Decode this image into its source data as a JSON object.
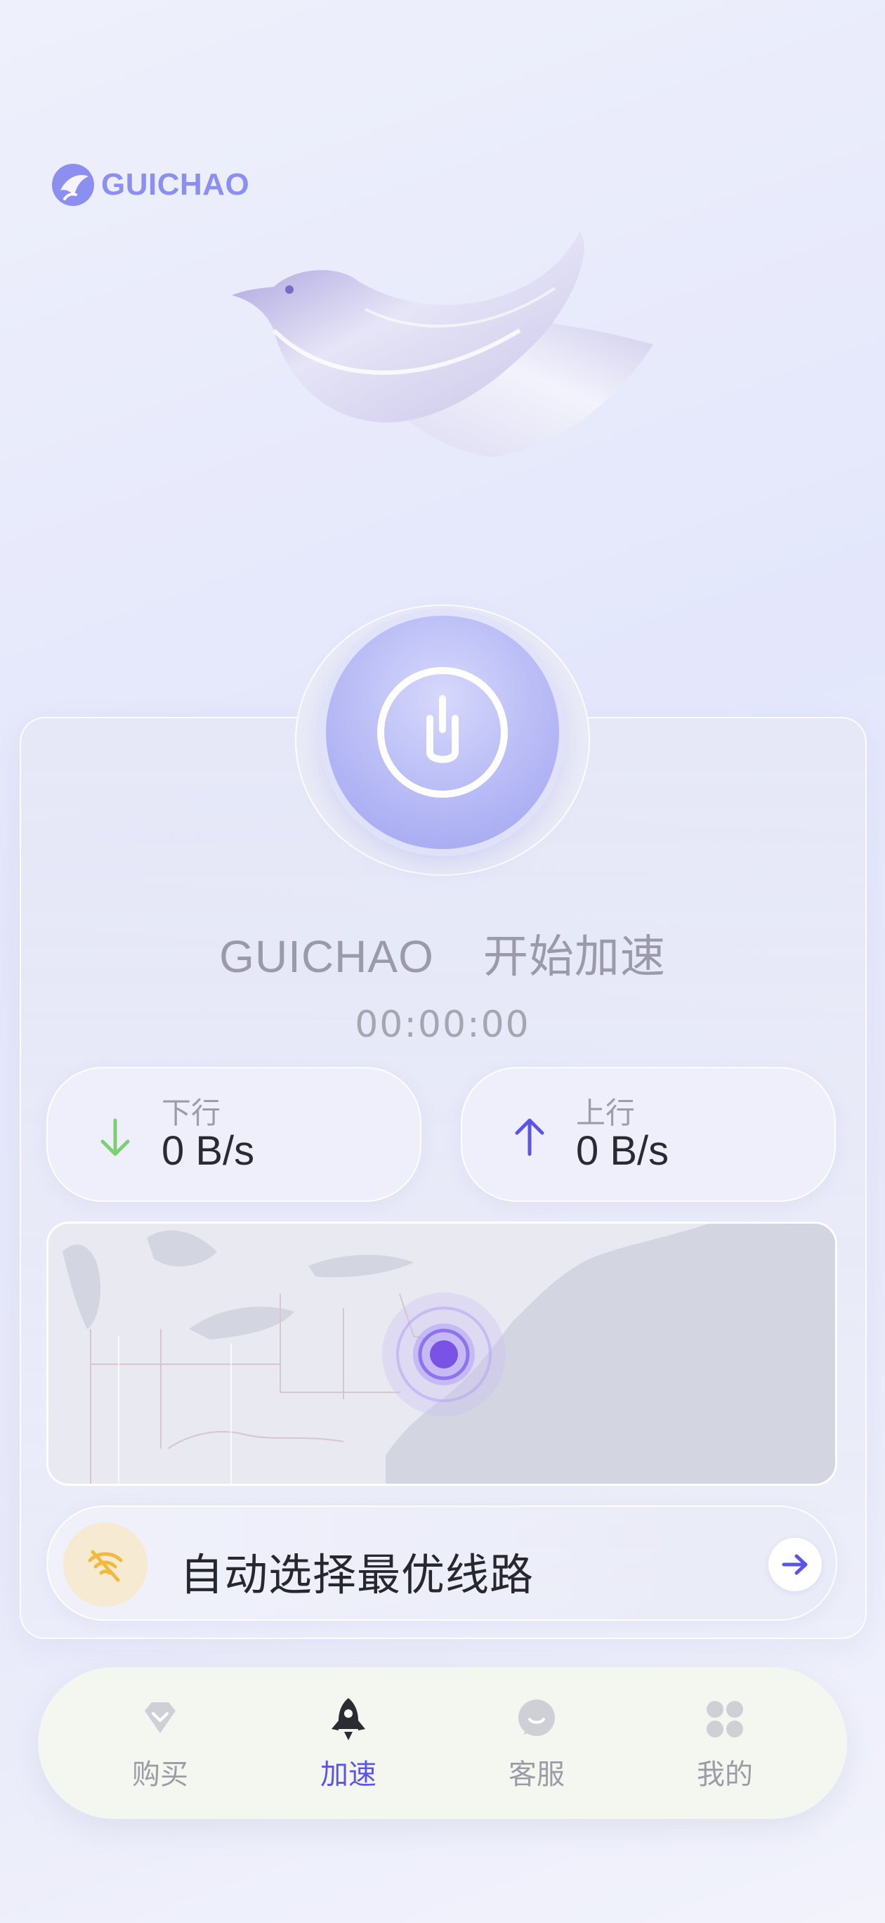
{
  "brand": {
    "name": "GUICHAO",
    "accent": "#6b63e6"
  },
  "main": {
    "title_brand": "GUICHAO",
    "title_action": "开始加速",
    "timer": "00:00:00",
    "download": {
      "label": "下行",
      "value": "0 B/s",
      "icon": "arrow-down-icon",
      "color": "#7ccf72"
    },
    "upload": {
      "label": "上行",
      "value": "0 B/s",
      "icon": "arrow-up-icon",
      "color": "#5b55e6"
    },
    "route": {
      "label": "自动选择最优线路",
      "icon": "wifi-off-icon",
      "action_icon": "arrow-right-icon"
    }
  },
  "tabs": [
    {
      "label": "购买",
      "icon": "diamond-icon",
      "active": false
    },
    {
      "label": "加速",
      "icon": "rocket-icon",
      "active": true
    },
    {
      "label": "客服",
      "icon": "chat-icon",
      "active": false
    },
    {
      "label": "我的",
      "icon": "grid-icon",
      "active": false
    }
  ]
}
